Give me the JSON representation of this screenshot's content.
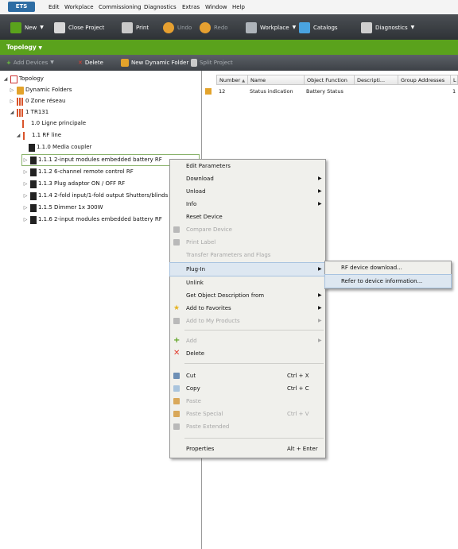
{
  "app": {
    "logo": "ETS"
  },
  "menubar": [
    "Edit",
    "Workplace",
    "Commissioning",
    "Diagnostics",
    "Extras",
    "Window",
    "Help"
  ],
  "toolbar": {
    "new": "New",
    "close_project": "Close Project",
    "print": "Print",
    "undo": "Undo",
    "redo": "Redo",
    "workplace": "Workplace",
    "catalogs": "Catalogs",
    "diagnostics": "Diagnostics"
  },
  "panel": {
    "title": "Topology"
  },
  "subbar": {
    "add_devices": "Add Devices",
    "delete": "Delete",
    "new_dynamic_folder": "New Dynamic Folder",
    "split_project": "Split Project"
  },
  "tree": [
    "Topology",
    "Dynamic Folders",
    "0 Zone réseau",
    "1 TR131",
    "1.0 Ligne principale",
    "1.1 RF line",
    "1.1.0  Media coupler",
    "1.1.1  2-input modules embedded battery RF",
    "1.1.2  6-channel remote control RF",
    "1.1.3  Plug adaptor ON / OFF RF",
    "1.1.4  2-fold input/1-fold output Shutters/blinds en",
    "1.1.5  Dimmer 1x 300W",
    "1.1.6  2-input modules embedded battery RF"
  ],
  "list": {
    "columns": [
      "Number",
      "Name",
      "Object Function",
      "Descripti...",
      "Group Addresses",
      "L"
    ],
    "rows": [
      {
        "number": "12",
        "name": "Status indication",
        "function": "Battery Status",
        "description": "",
        "groups": "",
        "l": "1"
      }
    ]
  },
  "context_menu": {
    "edit_parameters": "Edit Parameters",
    "download": "Download",
    "unload": "Unload",
    "info": "Info",
    "reset_device": "Reset Device",
    "compare_device": "Compare Device",
    "print_label": "Print Label",
    "transfer_parameters": "Transfer Parameters and Flags",
    "plug_in": "Plug-In",
    "unlink": "Unlink",
    "get_object_description": "Get Object Description from",
    "add_to_favorites": "Add to Favorites",
    "add_to_my_products": "Add to My Products",
    "add": "Add",
    "delete": "Delete",
    "cut": "Cut",
    "cut_sc": "Ctrl + X",
    "copy": "Copy",
    "copy_sc": "Ctrl + C",
    "paste": "Paste",
    "paste_special": "Paste Special",
    "paste_special_sc": "Ctrl + V",
    "paste_extended": "Paste Extended",
    "properties": "Properties",
    "properties_sc": "Alt + Enter"
  },
  "submenu": {
    "rf_download": "RF device download...",
    "refer_info": "Refer to device information..."
  },
  "colors": {
    "accent_green": "#5aa21c",
    "toolbar_dark": "#3a3e43",
    "highlight": "#dde7f1"
  }
}
